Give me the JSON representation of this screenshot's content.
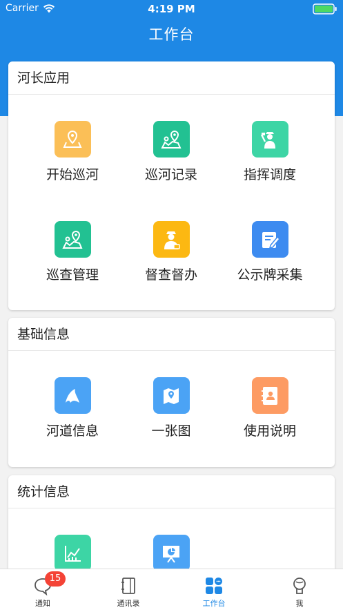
{
  "status": {
    "carrier": "Carrier",
    "time": "4:19 PM"
  },
  "nav": {
    "title": "工作台"
  },
  "sections": {
    "river_apps": {
      "title": "河长应用",
      "items": [
        {
          "label": "开始巡河",
          "icon": "map-pin-icon",
          "color": "#fbbf57"
        },
        {
          "label": "巡河记录",
          "icon": "map-route-icon",
          "color": "#22c192"
        },
        {
          "label": "指挥调度",
          "icon": "commander-icon",
          "color": "#3dd5a5"
        },
        {
          "label": "巡查管理",
          "icon": "map-route-icon",
          "color": "#22c192"
        },
        {
          "label": "督查督办",
          "icon": "inspector-icon",
          "color": "#fcb812"
        },
        {
          "label": "公示牌采集",
          "icon": "edit-doc-icon",
          "color": "#3d8bf0"
        }
      ]
    },
    "basic_info": {
      "title": "基础信息",
      "items": [
        {
          "label": "河道信息",
          "icon": "river-icon",
          "color": "#4ba3f5"
        },
        {
          "label": "一张图",
          "icon": "map-icon",
          "color": "#4ba3f5"
        },
        {
          "label": "使用说明",
          "icon": "contacts-book-icon",
          "color": "#fd9b63"
        }
      ]
    },
    "stats": {
      "title": "统计信息",
      "items": [
        {
          "label": "",
          "icon": "line-chart-icon",
          "color": "#3dd5a5"
        },
        {
          "label": "",
          "icon": "presentation-chart-icon",
          "color": "#4ba3f5"
        }
      ]
    }
  },
  "tabbar": {
    "items": [
      {
        "label": "通知",
        "badge": "15"
      },
      {
        "label": "通讯录"
      },
      {
        "label": "工作台"
      },
      {
        "label": "我"
      }
    ],
    "active_color": "#1e88e5"
  }
}
